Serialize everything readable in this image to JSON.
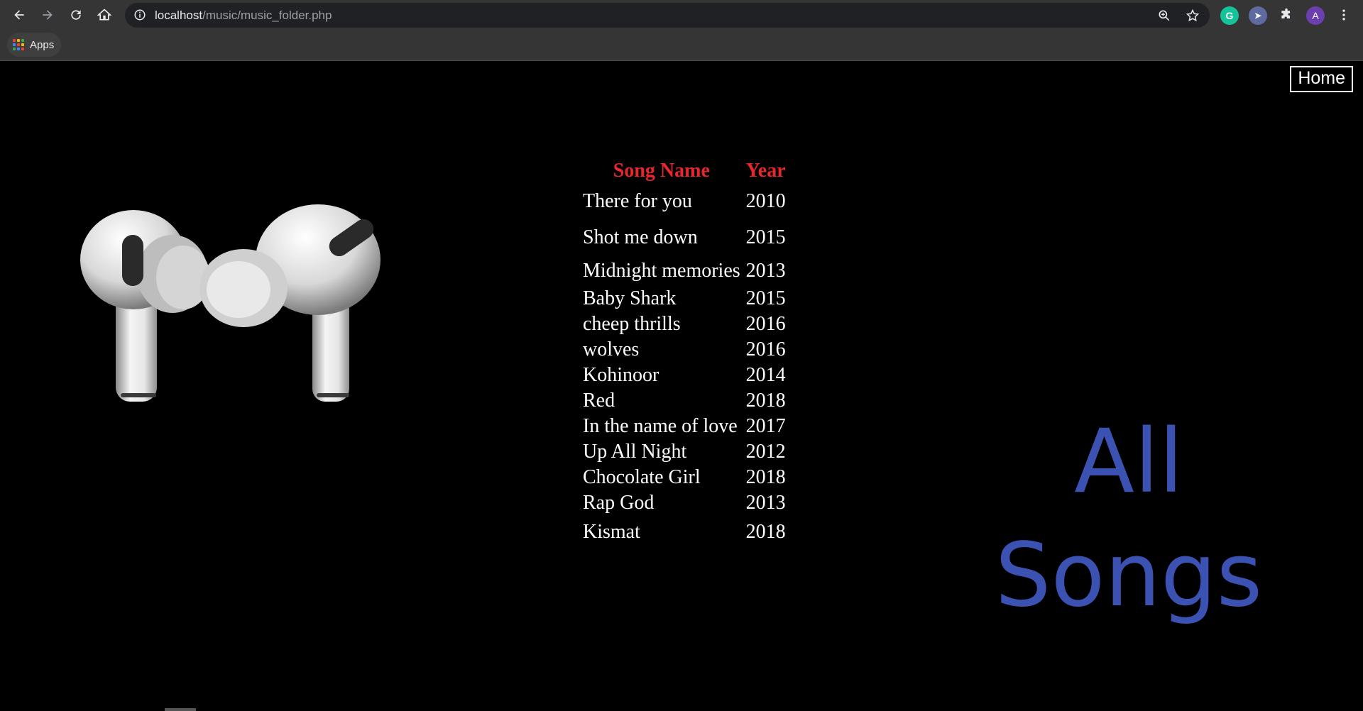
{
  "browser": {
    "url_host": "localhost",
    "url_path": "/music/music_folder.php",
    "bookmarks": {
      "apps_label": "Apps"
    },
    "profile_initial": "A",
    "icons": [
      "back-icon",
      "forward-icon",
      "reload-icon",
      "home-icon",
      "info-icon",
      "zoom-icon",
      "star-icon",
      "grammarly-icon",
      "extension-icon",
      "puzzle-icon",
      "menu-icon"
    ]
  },
  "page": {
    "home_label": "Home",
    "title_line1": "All",
    "title_line2": "Songs",
    "title_color": "#3c52b2",
    "header_color": "#e8262e"
  },
  "songs_table": {
    "headers": [
      "Song Name",
      "Year"
    ],
    "rows": [
      {
        "name": "There for you",
        "year": "2010"
      },
      {
        "name": "Shot me down",
        "year": "2015"
      },
      {
        "name": "Midnight memories",
        "year": "2013"
      },
      {
        "name": "Baby Shark",
        "year": "2015"
      },
      {
        "name": "cheep thrills",
        "year": "2016"
      },
      {
        "name": "wolves",
        "year": "2016"
      },
      {
        "name": "Kohinoor",
        "year": "2014"
      },
      {
        "name": "Red",
        "year": "2018"
      },
      {
        "name": "In the name of love",
        "year": "2017"
      },
      {
        "name": "Up All Night",
        "year": "2012"
      },
      {
        "name": "Chocolate Girl",
        "year": "2018"
      },
      {
        "name": "Rap God",
        "year": "2013"
      },
      {
        "name": "Kismat",
        "year": "2018"
      }
    ]
  }
}
